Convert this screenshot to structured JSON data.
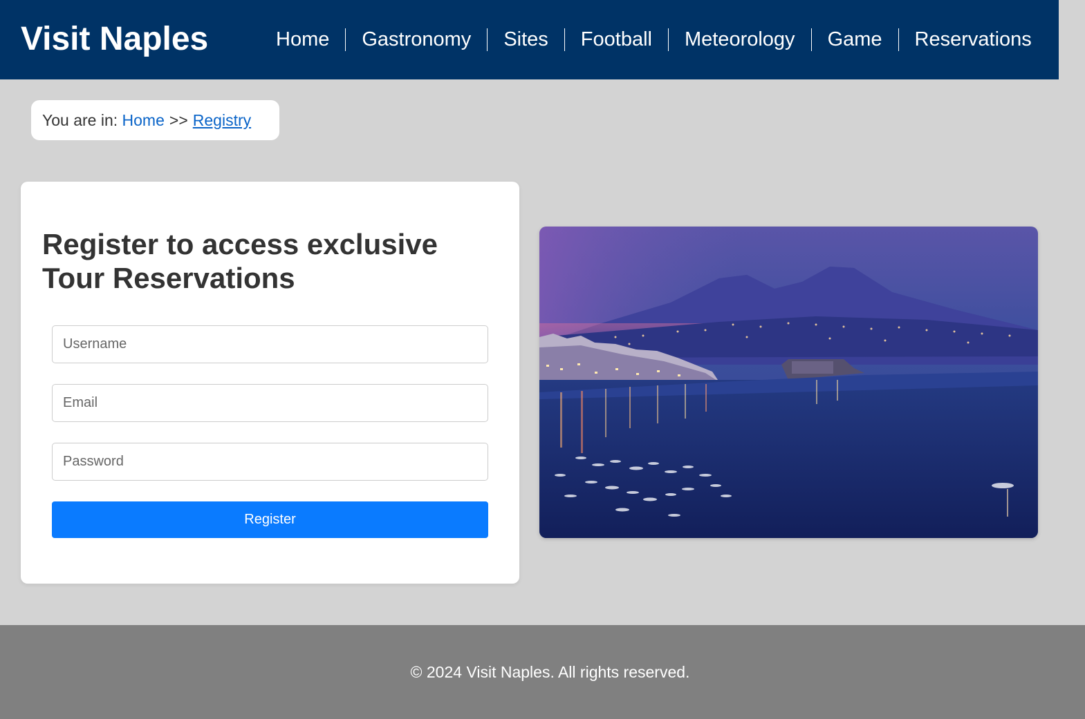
{
  "header": {
    "title": "Visit Naples",
    "nav": [
      {
        "label": "Home"
      },
      {
        "label": "Gastronomy"
      },
      {
        "label": "Sites"
      },
      {
        "label": "Football"
      },
      {
        "label": "Meteorology"
      },
      {
        "label": "Game"
      },
      {
        "label": "Reservations"
      }
    ]
  },
  "breadcrumb": {
    "prefix": "You are in:",
    "home": "Home",
    "separator": ">>",
    "current": "Registry"
  },
  "register": {
    "title": "Register to access exclusive Tour Reservations",
    "username_placeholder": "Username",
    "email_placeholder": "Email",
    "password_placeholder": "Password",
    "button_label": "Register"
  },
  "hero_image": {
    "icon": "naples-bay-night-photo"
  },
  "footer": {
    "text": "© 2024 Visit Naples. All rights reserved."
  },
  "colors": {
    "header_bg": "#003366",
    "page_bg": "#d3d3d3",
    "footer_bg": "#808080",
    "button_bg": "#0a7bff",
    "link": "#0a64c8"
  }
}
